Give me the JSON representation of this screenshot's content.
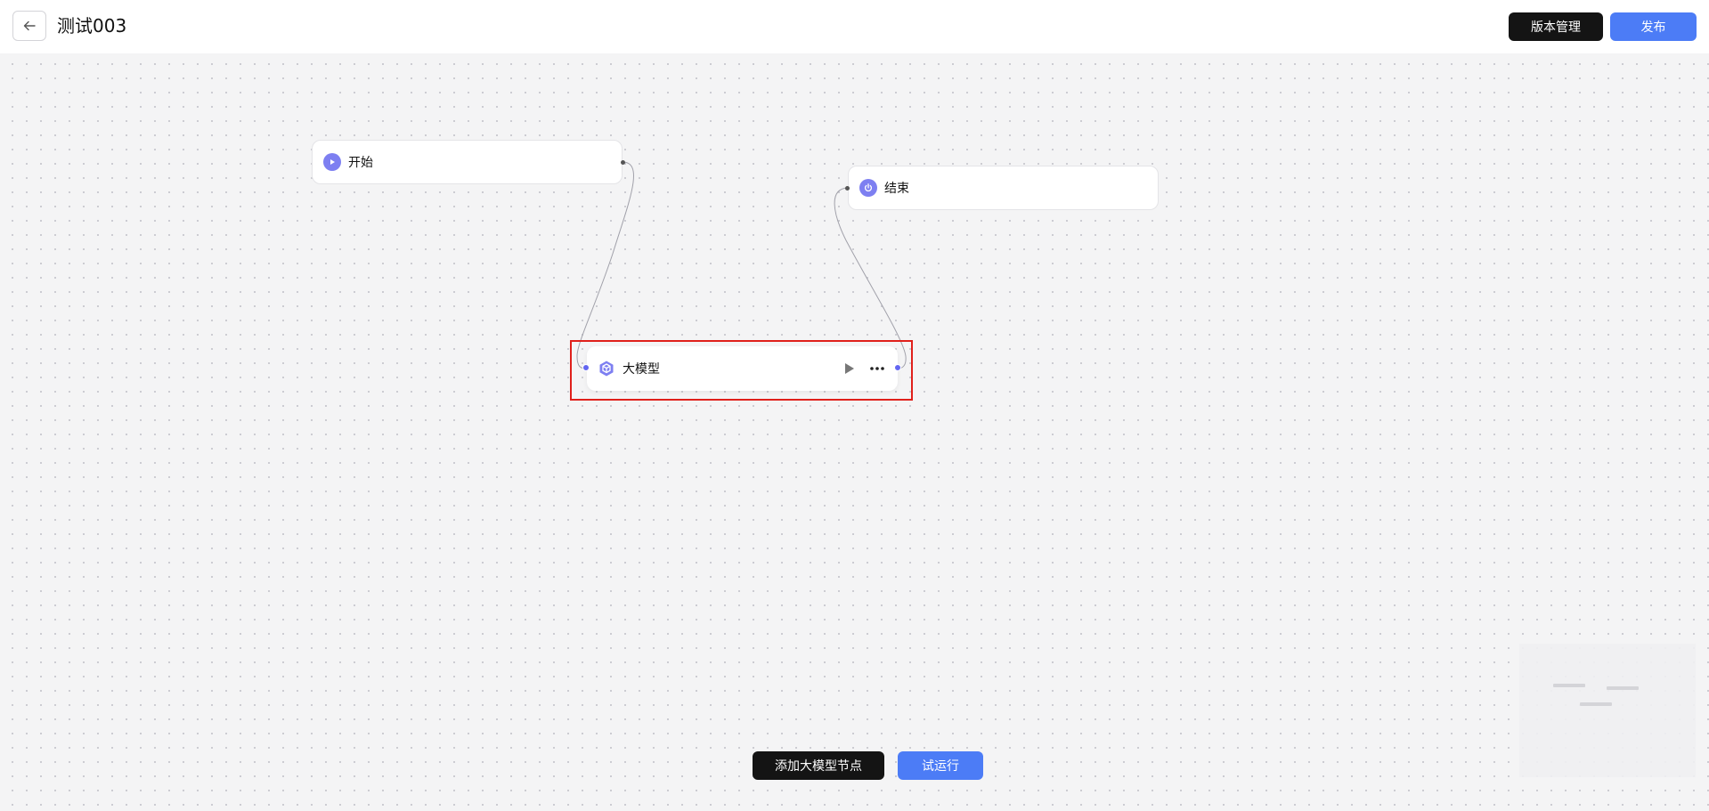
{
  "header": {
    "title": "测试003",
    "version_label": "版本管理",
    "publish_label": "发布"
  },
  "workflow": {
    "nodes": {
      "start": {
        "label": "开始",
        "icon": "play-circle-icon"
      },
      "end": {
        "label": "结束",
        "icon": "power-icon"
      },
      "llm": {
        "label": "大模型",
        "icon": "cube-icon",
        "selected": true
      }
    }
  },
  "footer": {
    "add_label": "添加大模型节点",
    "run_label": "试运行"
  },
  "colors": {
    "accent": "#4c7cf6",
    "dark": "#141414",
    "node_icon": "#7d7ff1",
    "selection": "#e0201b"
  }
}
